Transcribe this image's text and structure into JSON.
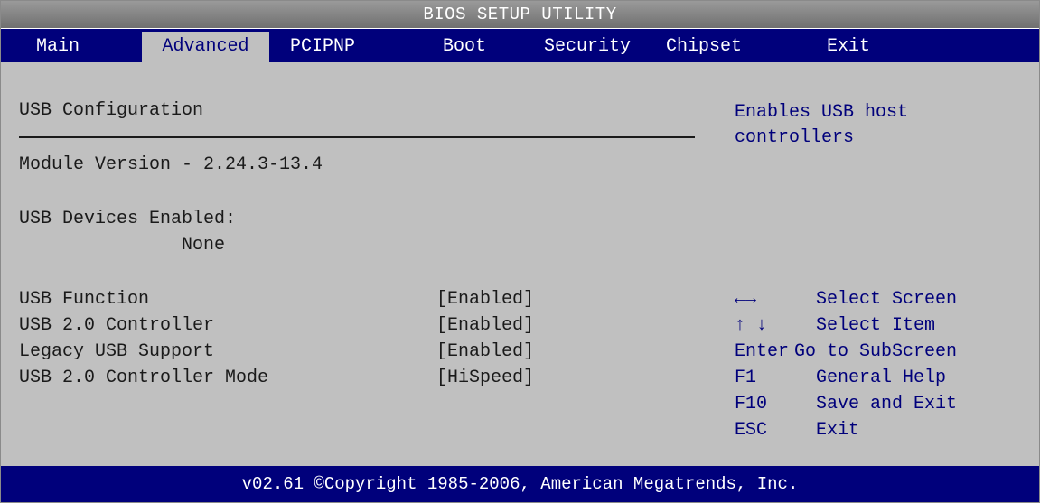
{
  "title": "BIOS SETUP UTILITY",
  "tabs": [
    {
      "label": "Main"
    },
    {
      "label": "Advanced"
    },
    {
      "label": "PCIPNP"
    },
    {
      "label": "Boot"
    },
    {
      "label": "Security"
    },
    {
      "label": "Chipset"
    },
    {
      "label": "Exit"
    }
  ],
  "active_tab": "Advanced",
  "main": {
    "heading": "USB Configuration",
    "module_version": "Module Version - 2.24.3-13.4",
    "devices_label": "USB Devices Enabled:",
    "devices_value": "None",
    "settings": [
      {
        "label": "USB Function",
        "value": "[Enabled]"
      },
      {
        "label": "USB 2.0 Controller",
        "value": "[Enabled]"
      },
      {
        "label": "Legacy USB Support",
        "value": "[Enabled]"
      },
      {
        "label": "USB 2.0 Controller Mode",
        "value": "[HiSpeed]"
      }
    ]
  },
  "help": {
    "line1": "Enables USB host",
    "line2": "controllers"
  },
  "keys": [
    {
      "key": "←→",
      "action": "Select Screen",
      "icon": "left-right-arrow-icon"
    },
    {
      "key": "↑ ↓",
      "action": "Select Item",
      "icon": "up-down-arrow-icon"
    },
    {
      "key": "Enter",
      "action": "Go to SubScreen"
    },
    {
      "key": "F1",
      "action": "General Help"
    },
    {
      "key": "F10",
      "action": "Save and Exit"
    },
    {
      "key": "ESC",
      "action": "Exit"
    }
  ],
  "footer": "v02.61 ©Copyright 1985-2006, American Megatrends, Inc.",
  "colors": {
    "menubar": "#00007b",
    "panel": "#c0c0c0",
    "titlebar": "#808080",
    "help_text": "#00007b"
  }
}
